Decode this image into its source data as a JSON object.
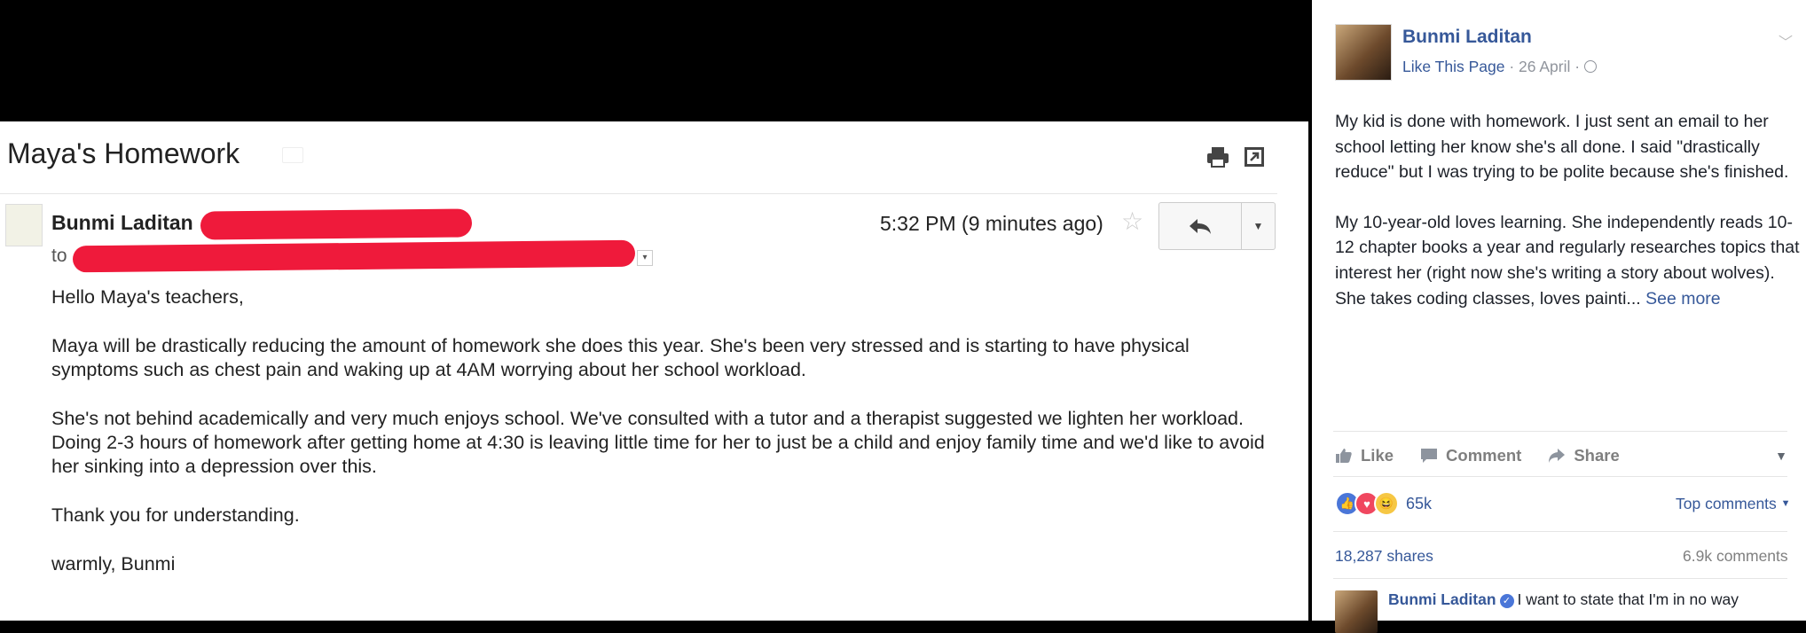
{
  "email": {
    "subject": "Maya's Homework",
    "sender_name": "Bunmi Laditan",
    "to_label": "to",
    "timestamp": "5:32 PM (9 minutes ago)",
    "body": {
      "greeting": "Hello Maya's teachers,",
      "paragraph_1": "Maya will be drastically reducing the amount of homework she does this year. She's been very stressed and is starting to have physical symptoms such as chest pain and waking up at 4AM worrying about her school workload.",
      "paragraph_2": "She's not behind academically and very much enjoys school. We've consulted with a tutor and a therapist suggested we lighten her workload. Doing 2-3 hours of homework after getting home at 4:30 is leaving little time for her to just be a child and enjoy family time and we'd like to avoid her sinking into a depression over this.",
      "paragraph_3": "Thank you for understanding.",
      "signoff": "warmly, Bunmi"
    },
    "redaction_color": "#ef1a3b"
  },
  "facebook": {
    "author": "Bunmi Laditan",
    "like_page": "Like This Page",
    "separator": " · ",
    "date": "26 April",
    "post_text_1": "My kid is done with homework. I just sent an email to her school letting her know she's all done. I said \"drastically reduce\" but I was trying to be polite because she's finished.",
    "post_text_2": "My 10-year-old loves learning. She independently reads 10-12 chapter books a year and regularly researches topics that interest her (right now she's writing a story about wolves). She takes coding classes, loves painti...",
    "see_more": "See more",
    "actions": {
      "like": "Like",
      "comment": "Comment",
      "share": "Share"
    },
    "reaction_count": "65k",
    "top_comments": "Top comments",
    "shares": "18,287 shares",
    "comments_count": "6.9k comments",
    "comment": {
      "author": "Bunmi Laditan",
      "text": "I want to state that I'm in no way"
    },
    "accent_color": "#365899"
  }
}
